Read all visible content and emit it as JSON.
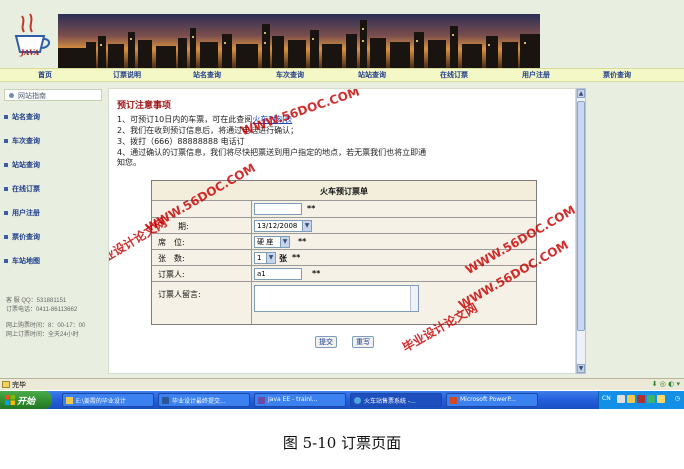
{
  "logo_text": "JAVA",
  "nav": [
    "首页",
    "订票说明",
    "站名查询",
    "车次查询",
    "站站查询",
    "在线订票",
    "用户注册",
    "票价查询"
  ],
  "sidebar": {
    "header": "网站指南",
    "items": [
      "站名查询",
      "车次查询",
      "站站查询",
      "在线订票",
      "用户注册",
      "票价查询",
      "车站地图"
    ],
    "contact": [
      "客 服 QQ：531881151",
      "订票电话：0411-86113662",
      "网上购票时间：8：00-17：00",
      "网上订票时间：全天24小时"
    ]
  },
  "notice": {
    "title": "预订注意事项",
    "line1_prefix": "1、可预订10日内的车票，可在此查阅",
    "line1_link": "火车时刻表",
    "line2": "2、我们在收到预订信息后，将通过电话进行确认；",
    "line3": "3、拨打（666）88888888 电话订",
    "line4": "4、通过确认的订票信息，我们将尽快把票送到用户指定的地点，若无票我们也将立即通",
    "line5": "知您。"
  },
  "form": {
    "title": "火车预订票单",
    "date_label": "期:",
    "date_value": "13/12/2008",
    "seat_label": "席　位:",
    "seat_value": "硬 座",
    "count_label": "张　数:",
    "count_value": "1",
    "count_unit": "张",
    "name_label": "订票人:",
    "name_value": "a1",
    "message_label": "订票人留言:",
    "required_mark": "**",
    "submit_label": "提交",
    "reset_label": "重写"
  },
  "watermark": {
    "url": "WWW.56DOC.COM",
    "cn": "毕业设计论文网"
  },
  "statusbar": {
    "text": "完毕"
  },
  "taskbar": {
    "start": "开始",
    "tasks": [
      "E:\\姜霞的毕业设计",
      "毕业设计最终提交...",
      "Java EE - trainl...",
      "火车站售票系统 -...",
      "Microsoft PowerP..."
    ],
    "lang": "CN"
  },
  "caption": "图 5-10  订票页面",
  "colors": {
    "accent": "#1f3d8c",
    "notice_title": "#a01818",
    "watermark": "#c80000",
    "taskbar": "#245edb"
  }
}
